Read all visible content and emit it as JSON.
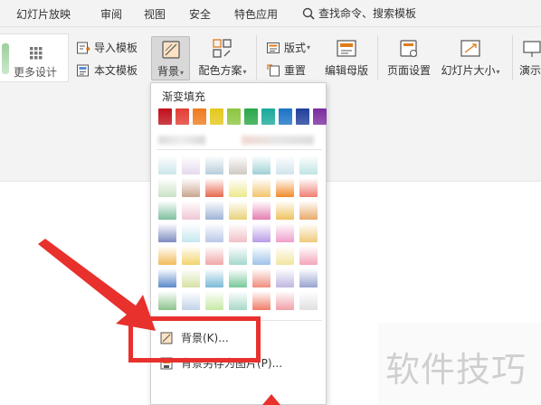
{
  "menubar": {
    "items": [
      "幻灯片放映",
      "审阅",
      "视图",
      "安全",
      "特色应用"
    ],
    "search_label": "查找命令、搜索模板"
  },
  "ribbon": {
    "more_design": "更多设计",
    "import_template": "导入模板",
    "text_template": "本文模板",
    "background": "背景",
    "color_scheme": "配色方案",
    "layout": "版式",
    "reset": "重置",
    "edit_master": "编辑母版",
    "page_setup": "页面设置",
    "slide_size": "幻灯片大小",
    "presenter": "演示"
  },
  "dropdown": {
    "section_title": "渐变填充",
    "solid_colors": [
      "#c0101a",
      "#e23c33",
      "#ef7b1f",
      "#e4c81c",
      "#8cc640",
      "#29a747",
      "#1aa99a",
      "#1b73c6",
      "#213f9b",
      "#7b2c9e"
    ],
    "gradients": [
      [
        "#cbe6ea",
        "#e6d9ee",
        "#b8cddb",
        "#cfc8c3",
        "#9fd1d6",
        "#cfe4ec",
        "#bfe3e4"
      ],
      [
        "#c9e2c4",
        "#c9a68f",
        "#e7684d",
        "#ecea8d",
        "#f4c46c",
        "#f08a28",
        "#ef7f72"
      ],
      [
        "#7fbf9f",
        "#efc7d5",
        "#9fb4d7",
        "#e8d27a",
        "#e57fb2",
        "#f0c25e",
        "#e9aa6b"
      ],
      [
        "#7d8bc0",
        "#c6e7ef",
        "#b9c7e6",
        "#f0c0c7",
        "#b89ce6",
        "#ef9fc9",
        "#f0c97a"
      ],
      [
        "#f2bb5a",
        "#f3d36c",
        "#f0a7a8",
        "#a6d7cd",
        "#9fc3ea",
        "#f2e5a0",
        "#f3a6ba"
      ],
      [
        "#5b89c9",
        "#d6e2a5",
        "#7abad6",
        "#78c89a",
        "#ef8d7d",
        "#bfb6e0",
        "#98a3cf"
      ],
      [
        "#8cc38c",
        "#c2d4ea",
        "#c6eaa6",
        "#a8d8c7",
        "#f07d66",
        "#f0a0a8",
        "#e0e0e0"
      ]
    ],
    "background_item": "背景(K)...",
    "save_bg_item": "背景另存为图片(P)..."
  },
  "watermark": "软件技巧"
}
